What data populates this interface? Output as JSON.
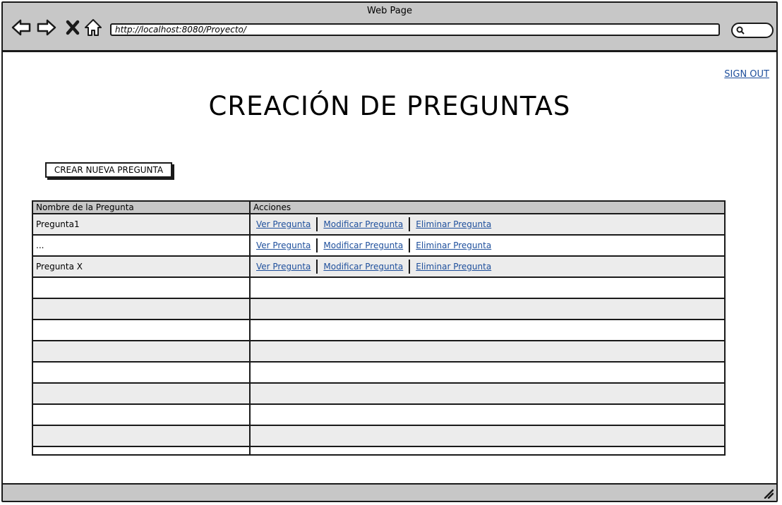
{
  "window": {
    "title": "Web Page"
  },
  "browser": {
    "url": "http://localhost:8080/Proyecto/",
    "icons": [
      "back-arrow-icon",
      "forward-arrow-icon",
      "close-icon",
      "home-icon",
      "search-icon"
    ]
  },
  "header": {
    "signout_label": "SIGN OUT"
  },
  "page": {
    "title": "CREACIÓN DE PREGUNTAS",
    "create_button_label": "CREAR NUEVA PREGUNTA"
  },
  "table": {
    "columns": [
      "Nombre de la Pregunta",
      "Acciones"
    ],
    "rows": [
      {
        "name": "Pregunta1",
        "actions": [
          "Ver Pregunta",
          "Modificar Pregunta",
          "Eliminar Pregunta"
        ]
      },
      {
        "name": "...",
        "actions": [
          "Ver Pregunta",
          "Modificar Pregunta",
          "Eliminar Pregunta"
        ]
      },
      {
        "name": "Pregunta X",
        "actions": [
          "Ver Pregunta",
          "Modificar Pregunta",
          "Eliminar Pregunta"
        ]
      }
    ],
    "empty_rows": 9
  },
  "colors": {
    "chrome": "#c7c7c7",
    "link": "#1e4f9c",
    "row_alt": "#ececec",
    "border": "#1a1a1a"
  }
}
